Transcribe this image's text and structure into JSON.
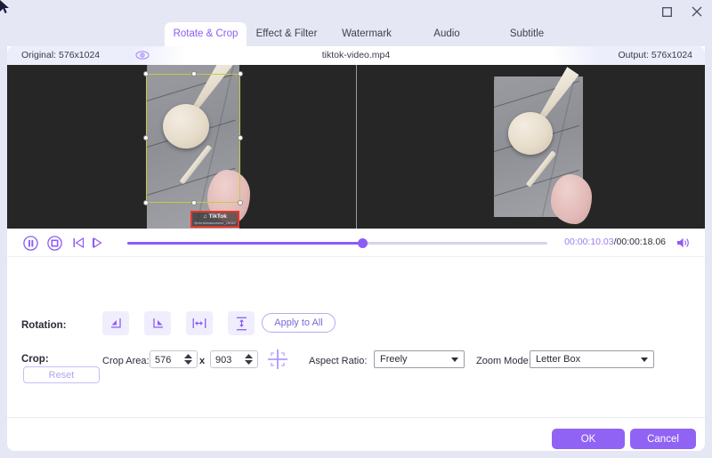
{
  "window": {
    "maximize_label": "Maximize",
    "close_label": "Close"
  },
  "tabs": [
    {
      "label": "Rotate & Crop",
      "active": true
    },
    {
      "label": "Effect & Filter",
      "active": false
    },
    {
      "label": "Watermark",
      "active": false
    },
    {
      "label": "Audio",
      "active": false
    },
    {
      "label": "Subtitle",
      "active": false
    }
  ],
  "info": {
    "original": "Original: 576x1024",
    "filename": "tiktok-video.mp4",
    "output": "Output: 576x1024",
    "preview_toggle_icon": "eye-icon"
  },
  "preview": {
    "watermark": {
      "brand": "TikTok",
      "user": "@christinascuisine_18042"
    }
  },
  "transport": {
    "pause_icon": "pause-icon",
    "stop_icon": "stop-icon",
    "prev_icon": "previous-frame-icon",
    "next_icon": "next-frame-icon",
    "current_time": "00:00:10.03",
    "separator": "/",
    "total_time": "00:00:18.06",
    "volume_icon": "volume-icon",
    "progress_percent": 56
  },
  "rotation": {
    "label": "Rotation:",
    "buttons": [
      {
        "name": "rotate-left-icon"
      },
      {
        "name": "rotate-right-icon"
      },
      {
        "name": "flip-horizontal-icon"
      },
      {
        "name": "flip-vertical-icon"
      }
    ],
    "apply_to_all": "Apply to All"
  },
  "crop": {
    "label": "Crop:",
    "reset": "Reset",
    "crop_area_label": "Crop Area:",
    "width": "576",
    "times": "x",
    "height": "903",
    "center_icon": "center-crop-icon",
    "aspect_ratio_label": "Aspect Ratio:",
    "aspect_ratio_value": "Freely",
    "zoom_mode_label": "Zoom Mode:",
    "zoom_mode_value": "Letter Box"
  },
  "footer": {
    "ok": "OK",
    "cancel": "Cancel"
  },
  "colors": {
    "accent": "#8b5cf6",
    "button": "#9163f5",
    "chrome": "#e5e7f4",
    "crop_outline": "#c9c93f",
    "highlight": "#e8352a"
  }
}
